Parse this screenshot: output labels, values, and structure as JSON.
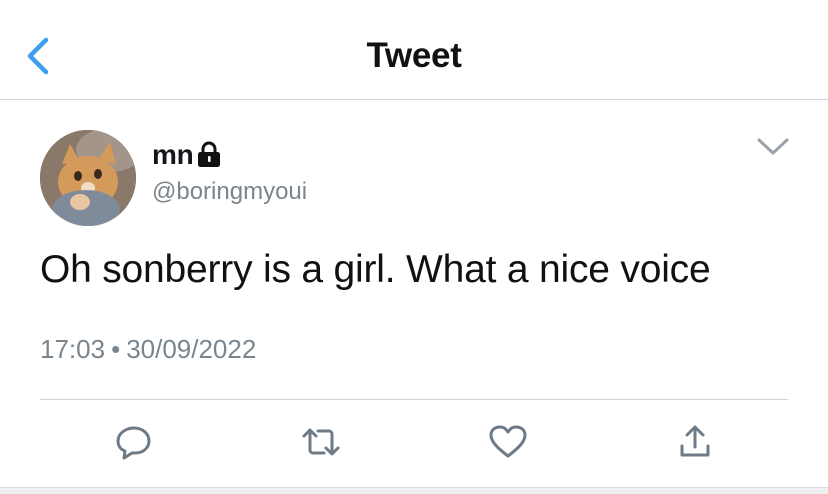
{
  "header": {
    "title": "Tweet"
  },
  "tweet": {
    "display_name": "mn",
    "handle": "@boringmyoui",
    "text": "Oh sonberry is a girl. What a nice voice",
    "time": "17:03",
    "separator": "•",
    "date": "30/09/2022"
  },
  "icons": {
    "back": "chevron-left-icon",
    "lock": "lock-icon",
    "more": "chevron-down-icon",
    "reply": "reply-icon",
    "retweet": "retweet-icon",
    "like": "heart-icon",
    "share": "share-icon"
  },
  "colors": {
    "accent": "#1da1f2",
    "secondary_text": "#7a858e",
    "divider": "#cfd4d8"
  }
}
